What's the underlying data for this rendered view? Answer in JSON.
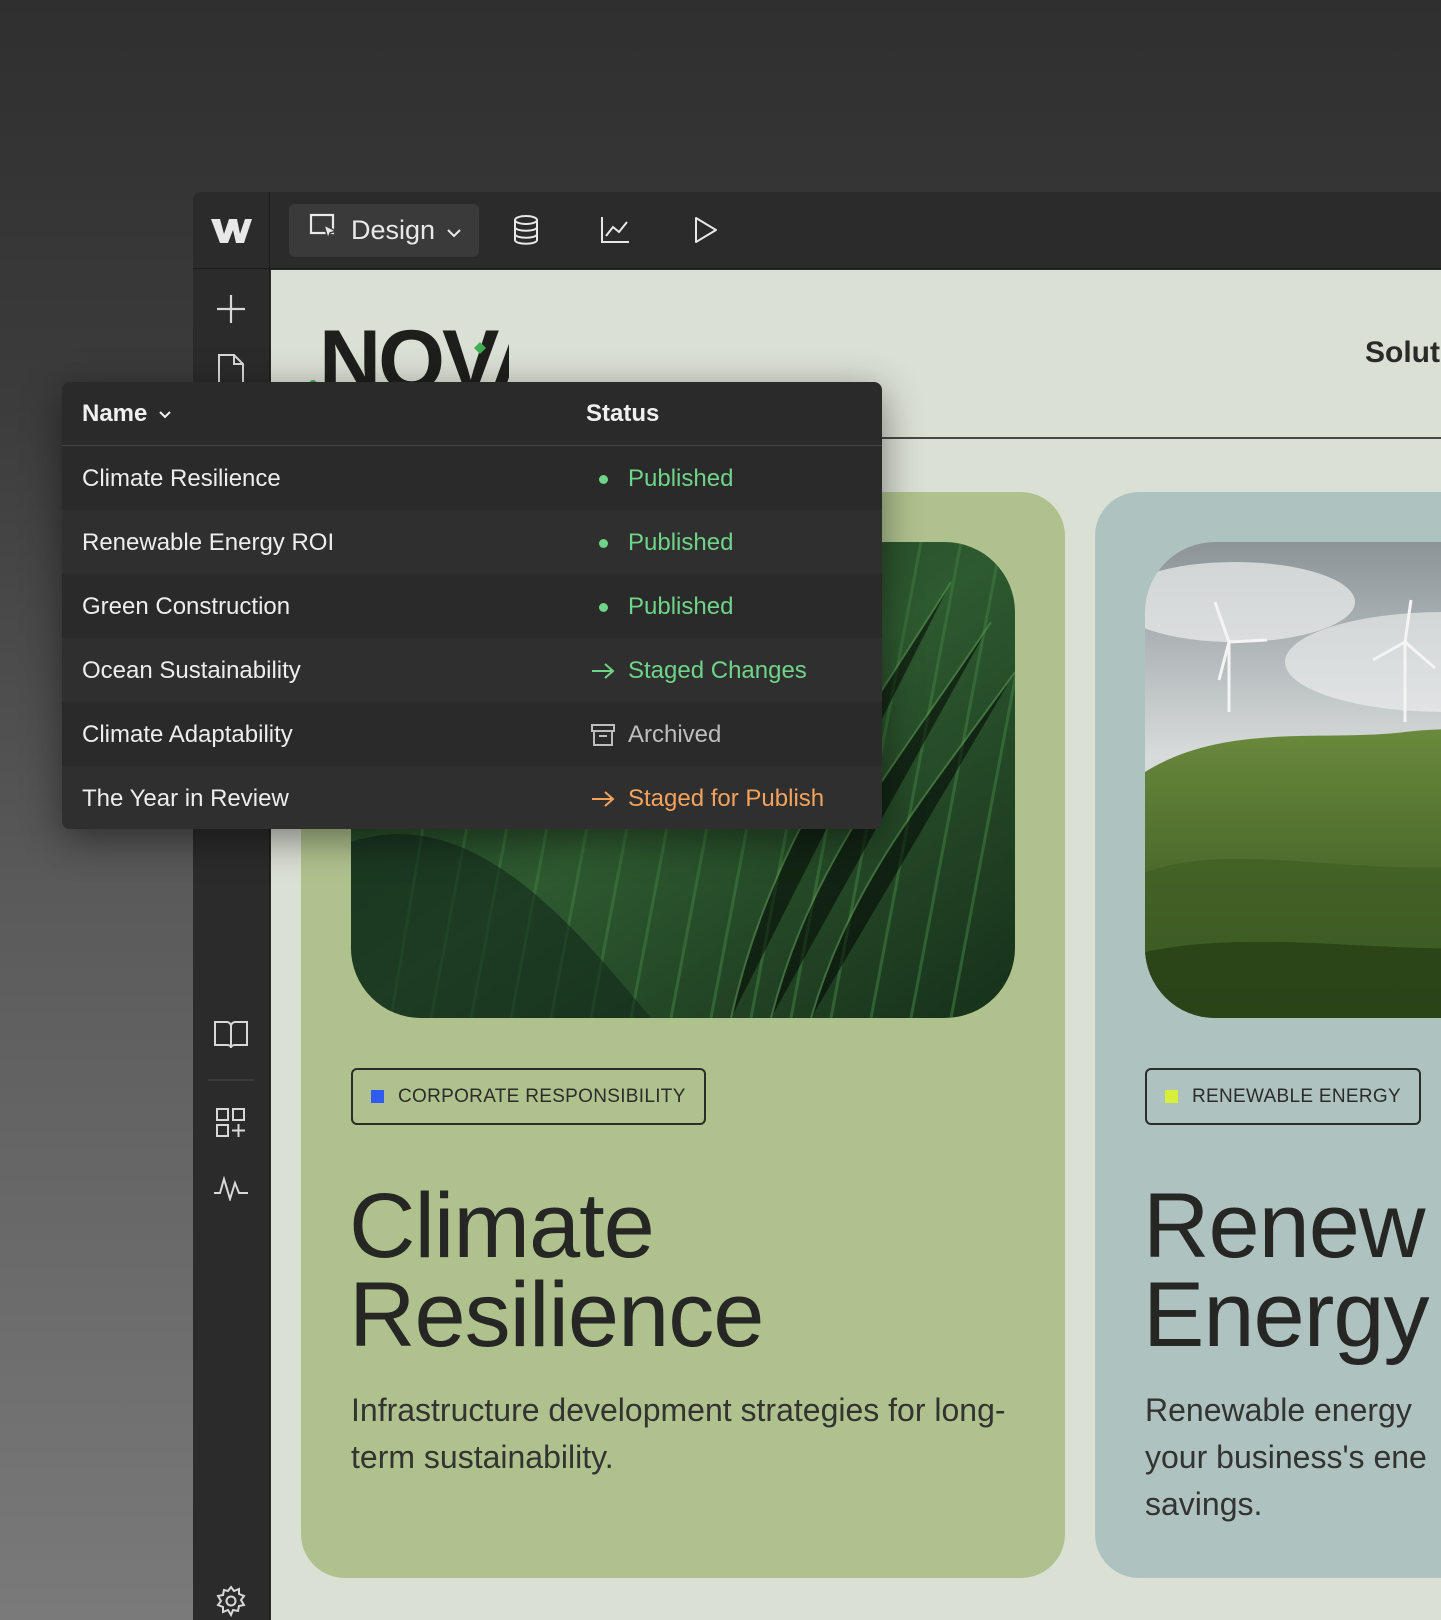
{
  "app": {
    "mode_label": "Design",
    "icons": [
      "webflow-logo-icon",
      "cursor-select-icon",
      "chevron-down-icon",
      "database-icon",
      "analytics-chart-icon",
      "play-preview-icon"
    ]
  },
  "sidebar": {
    "icons": [
      "add-icon",
      "page-icon",
      "book-icon",
      "apps-icon",
      "activity-icon",
      "settings-icon"
    ]
  },
  "site": {
    "brand": "NOVA",
    "nav_link": "Soluti",
    "cards": [
      {
        "tag": "CORPORATE RESPONSIBILITY",
        "tag_color": "#2f5bf0",
        "title_line1": "Climate",
        "title_line2": "Resilience",
        "desc": "Infrastructure development strategies for long-term sustainability."
      },
      {
        "tag": "RENEWABLE ENERGY",
        "tag_color": "#d8ef3a",
        "title_line1": "Renew",
        "title_line2": "Energy",
        "desc_line1": "Renewable energy",
        "desc_line2": "your business's ene",
        "desc_line3": "savings."
      }
    ]
  },
  "cms_table": {
    "col_name": "Name",
    "col_status": "Status",
    "rows": [
      {
        "name": "Climate Resilience",
        "status": "Published",
        "type": "published"
      },
      {
        "name": "Renewable Energy ROI",
        "status": "Published",
        "type": "published"
      },
      {
        "name": "Green Construction",
        "status": "Published",
        "type": "published"
      },
      {
        "name": "Ocean Sustainability",
        "status": "Staged Changes",
        "type": "staged"
      },
      {
        "name": "Climate Adaptability",
        "status": "Archived",
        "type": "archived"
      },
      {
        "name": "The Year in Review",
        "status": "Staged for Publish",
        "type": "publish"
      }
    ]
  },
  "colors": {
    "published": "#6fd488",
    "staged": "#6fd488",
    "archived": "#bdbdbd",
    "publish": "#f5a35c"
  }
}
